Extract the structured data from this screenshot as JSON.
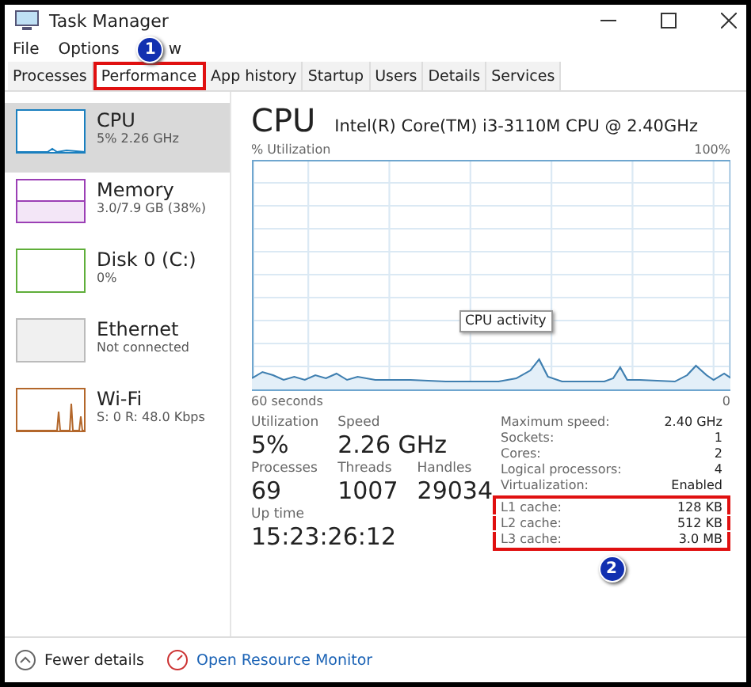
{
  "window": {
    "title": "Task Manager"
  },
  "menu": [
    "File",
    "Options",
    "w"
  ],
  "tabs": [
    {
      "label": "Processes",
      "selected": false
    },
    {
      "label": "Performance",
      "selected": true
    },
    {
      "label": "App history",
      "selected": false
    },
    {
      "label": "Startup",
      "selected": false
    },
    {
      "label": "Users",
      "selected": false
    },
    {
      "label": "Details",
      "selected": false
    },
    {
      "label": "Services",
      "selected": false
    }
  ],
  "sidebar": {
    "items": [
      {
        "name": "CPU",
        "detail": "5% 2.26 GHz",
        "color": "#1a7fbf",
        "selected": true
      },
      {
        "name": "Memory",
        "detail": "3.0/7.9 GB (38%)",
        "color": "#9b3fb5",
        "selected": false
      },
      {
        "name": "Disk 0 (C:)",
        "detail": "0%",
        "color": "#5fae3a",
        "selected": false
      },
      {
        "name": "Ethernet",
        "detail": "Not connected",
        "color": "#bbbbbb",
        "selected": false
      },
      {
        "name": "Wi-Fi",
        "detail": "S: 0 R: 48.0 Kbps",
        "color": "#b3672b",
        "selected": false
      }
    ]
  },
  "main": {
    "title": "CPU",
    "model": "Intel(R) Core(TM) i3-3110M CPU @ 2.40GHz",
    "graph_label": "% Utilization",
    "graph_max": "100%",
    "graph_time": "60 seconds",
    "graph_min": "0",
    "tooltip": "CPU activity",
    "stats": [
      {
        "label": "Utilization",
        "value": "5%"
      },
      {
        "label": "Speed",
        "value": "2.26 GHz"
      },
      {
        "label": "Processes",
        "value": "69"
      },
      {
        "label": "Threads",
        "value": "1007"
      },
      {
        "label": "Handles",
        "value": "29034"
      },
      {
        "label": "Up time",
        "value": "15:23:26:12"
      }
    ],
    "specs": [
      {
        "label": "Maximum speed:",
        "value": "2.40 GHz",
        "highlighted": false
      },
      {
        "label": "Sockets:",
        "value": "1",
        "highlighted": false
      },
      {
        "label": "Cores:",
        "value": "2",
        "highlighted": false
      },
      {
        "label": "Logical processors:",
        "value": "4",
        "highlighted": false
      },
      {
        "label": "Virtualization:",
        "value": "Enabled",
        "highlighted": false
      },
      {
        "label": "L1 cache:",
        "value": "128 KB",
        "highlighted": true
      },
      {
        "label": "L2 cache:",
        "value": "512 KB",
        "highlighted": true
      },
      {
        "label": "L3 cache:",
        "value": "3.0 MB",
        "highlighted": true
      }
    ]
  },
  "annotations": [
    "1",
    "2"
  ],
  "footer": {
    "fewer": "Fewer details",
    "monitor": "Open Resource Monitor"
  }
}
